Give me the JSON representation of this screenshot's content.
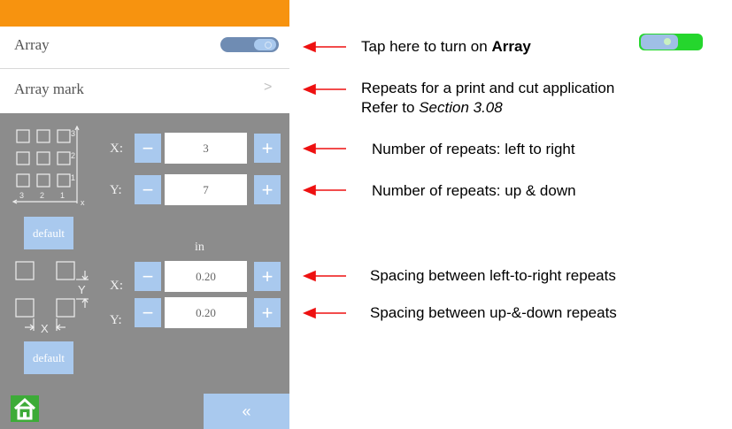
{
  "panel": {
    "array_label": "Array",
    "array_mark_label": "Array mark",
    "array_toggle_state": "on"
  },
  "repeat": {
    "x_axis": "X:",
    "y_axis": "Y:",
    "x_value": "3",
    "y_value": "7",
    "minus": "−",
    "plus": "+",
    "default_label": "default",
    "icon_labels": [
      "3",
      "2",
      "1"
    ]
  },
  "spacing": {
    "unit": "in",
    "x_axis": "X:",
    "y_axis": "Y:",
    "x_value": "0.20",
    "y_value": "0.20",
    "minus": "−",
    "plus": "+",
    "default_label": "default",
    "icon_x_label": "X",
    "icon_y_label": "Y"
  },
  "footer": {
    "back_glyph": "«"
  },
  "annotations": {
    "array_prefix": "Tap here to turn on ",
    "array_bold": "Array",
    "mark_line1": "Repeats for a print and cut application",
    "mark_line2_prefix": "Refer to ",
    "mark_line2_italic": "Section 3.08",
    "repeat_x": "Number of repeats: left to right",
    "repeat_y": "Number of repeats: up & down",
    "spacing_x": "Spacing between left-to-right repeats",
    "spacing_y": "Spacing between up-&-down repeats"
  },
  "colors": {
    "topbar": "#f7930f",
    "screen_bg": "#8c8c8c",
    "button": "#a9c9ee",
    "toggle_track": "#6f8cb3",
    "arrow": "#ee1111",
    "home": "#3dab38",
    "demo_toggle_on": "#25d62d"
  }
}
